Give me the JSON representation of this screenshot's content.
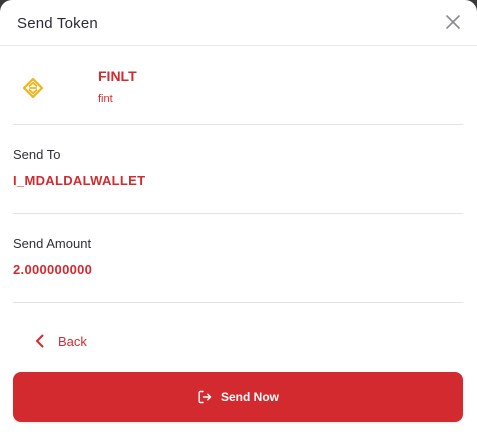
{
  "dialog": {
    "title": "Send Token"
  },
  "token": {
    "name": "FINLT",
    "symbol": "fint"
  },
  "send_to": {
    "label": "Send To",
    "value": "I_MDALDALWALLET"
  },
  "send_amount": {
    "label": "Send Amount",
    "value": "2.000000000"
  },
  "actions": {
    "back_label": "Back",
    "send_label": "Send Now"
  },
  "icons": {
    "close": "close-icon",
    "token_logo": "token-logo-icon",
    "back": "chevron-left-icon",
    "send": "logout-arrow-icon"
  },
  "colors": {
    "accent": "#d32a2f",
    "token_logo": "#f0b41c",
    "text": "#2b2b36"
  }
}
